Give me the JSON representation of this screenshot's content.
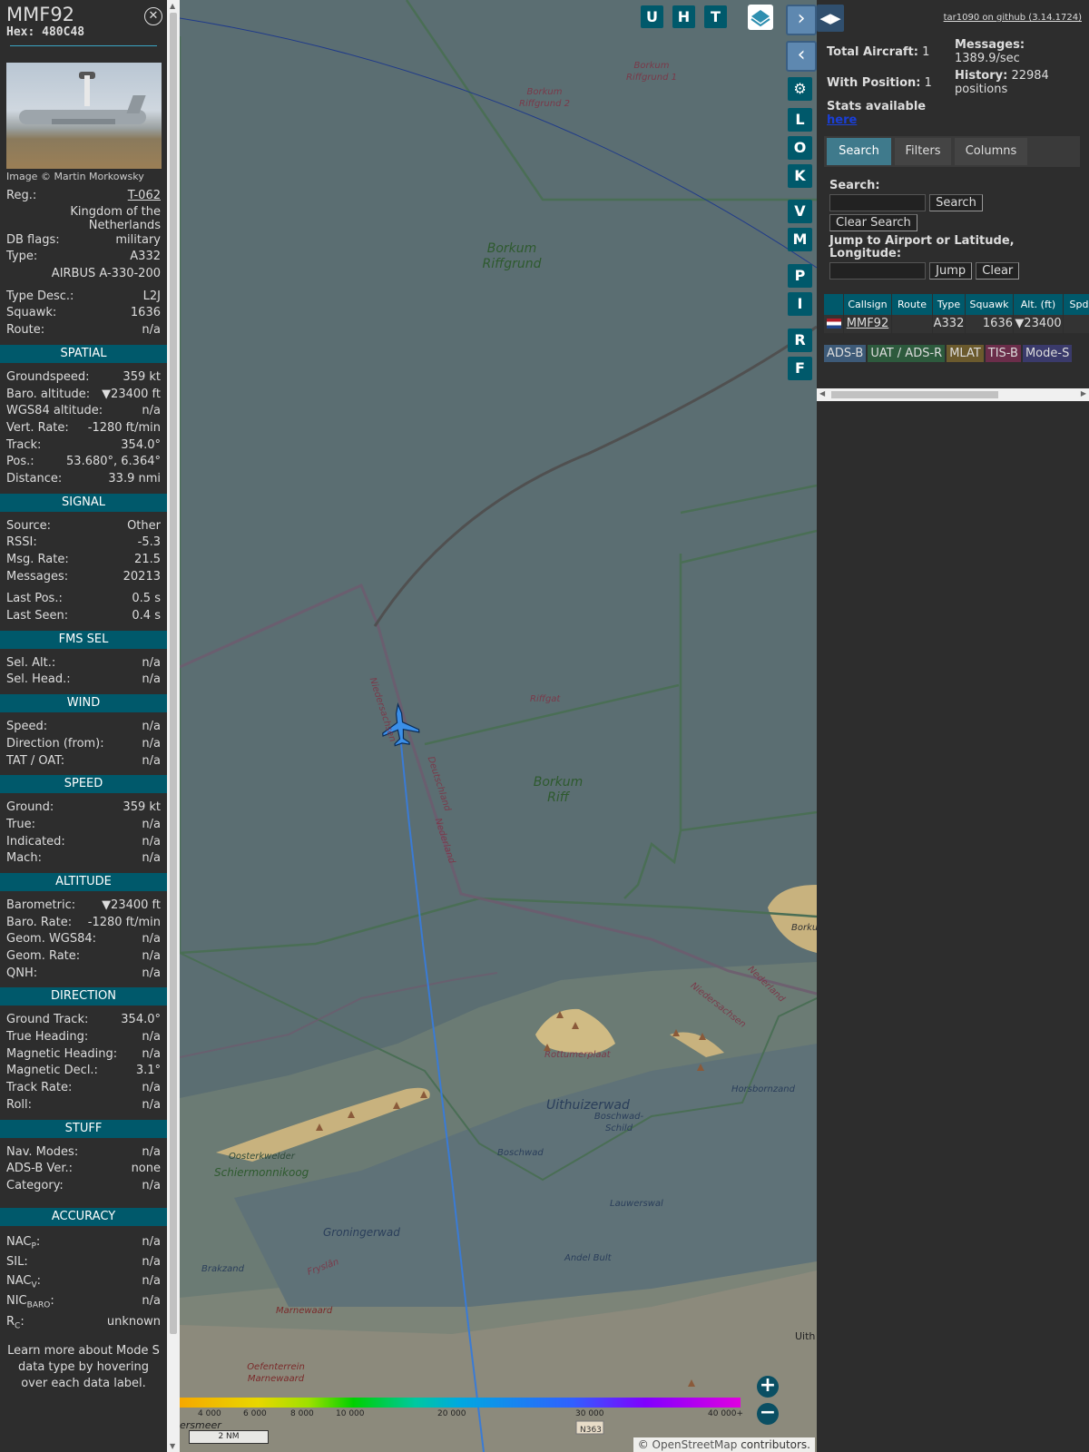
{
  "info": {
    "callsign": "MMF92",
    "hex_label": "Hex:",
    "hex": "480C48",
    "photo_credit": "Image © Martin Morkowsky",
    "header_rows": [
      {
        "k": "Reg.:",
        "v": "T-062"
      }
    ],
    "country": "Kingdom of the Netherlands",
    "rows_a": [
      {
        "k": "DB flags:",
        "v": "military"
      },
      {
        "k": "Type:",
        "v": "A332"
      }
    ],
    "type_full": "AIRBUS A-330-200",
    "rows_b": [
      {
        "k": "Type Desc.:",
        "v": "L2J"
      },
      {
        "k": "Squawk:",
        "v": "1636"
      },
      {
        "k": "Route:",
        "v": "n/a"
      }
    ],
    "sections": [
      {
        "title": "SPATIAL",
        "rows": [
          {
            "k": "Groundspeed:",
            "v": "359 kt"
          },
          {
            "k": "Baro. altitude:",
            "v": "▼23400 ft"
          },
          {
            "k": "WGS84 altitude:",
            "v": "n/a"
          },
          {
            "k": "Vert. Rate:",
            "v": "-1280 ft/min"
          },
          {
            "k": "Track:",
            "v": "354.0°"
          },
          {
            "k": "Pos.:",
            "v": "53.680°, 6.364°"
          },
          {
            "k": "Distance:",
            "v": "33.9 nmi"
          }
        ]
      },
      {
        "title": "SIGNAL",
        "rows": [
          {
            "k": "Source:",
            "v": "Other"
          },
          {
            "k": "RSSI:",
            "v": "-5.3"
          },
          {
            "k": "Msg. Rate:",
            "v": "21.5"
          },
          {
            "k": "Messages:",
            "v": "20213"
          },
          {
            "k": "Last Pos.:",
            "v": "0.5 s"
          },
          {
            "k": "Last Seen:",
            "v": "0.4 s"
          }
        ]
      },
      {
        "title": "FMS SEL",
        "rows": [
          {
            "k": "Sel. Alt.:",
            "v": "n/a"
          },
          {
            "k": "Sel. Head.:",
            "v": "n/a"
          }
        ]
      },
      {
        "title": "WIND",
        "rows": [
          {
            "k": "Speed:",
            "v": "n/a"
          },
          {
            "k": "Direction (from):",
            "v": "n/a"
          },
          {
            "k": "TAT / OAT:",
            "v": "n/a"
          }
        ]
      },
      {
        "title": "SPEED",
        "rows": [
          {
            "k": "Ground:",
            "v": "359 kt"
          },
          {
            "k": "True:",
            "v": "n/a"
          },
          {
            "k": "Indicated:",
            "v": "n/a"
          },
          {
            "k": "Mach:",
            "v": "n/a"
          }
        ]
      },
      {
        "title": "ALTITUDE",
        "rows": [
          {
            "k": "Barometric:",
            "v": "▼23400 ft"
          },
          {
            "k": "Baro. Rate:",
            "v": "-1280 ft/min"
          },
          {
            "k": "Geom. WGS84:",
            "v": "n/a"
          },
          {
            "k": "Geom. Rate:",
            "v": "n/a"
          },
          {
            "k": "QNH:",
            "v": "n/a"
          }
        ]
      },
      {
        "title": "DIRECTION",
        "rows": [
          {
            "k": "Ground Track:",
            "v": "354.0°"
          },
          {
            "k": "True Heading:",
            "v": "n/a"
          },
          {
            "k": "Magnetic Heading:",
            "v": "n/a"
          },
          {
            "k": "Magnetic Decl.:",
            "v": "3.1°"
          },
          {
            "k": "Track Rate:",
            "v": "n/a"
          },
          {
            "k": "Roll:",
            "v": "n/a"
          }
        ]
      },
      {
        "title": "STUFF",
        "rows": [
          {
            "k": "Nav. Modes:",
            "v": "n/a"
          },
          {
            "k": "ADS-B Ver.:",
            "v": "none"
          },
          {
            "k": "Category:",
            "v": "n/a"
          }
        ]
      }
    ],
    "accuracy_title": "ACCURACY",
    "accuracy": {
      "nacp_k": "NAC",
      "nacp_sub": "P",
      "nacp_v": "n/a",
      "sil_k": "SIL:",
      "sil_v": "n/a",
      "nacv_k": "NAC",
      "nacv_sub": "V",
      "nacv_v": "n/a",
      "nic_k": "NIC",
      "nic_sub": "BARO",
      "nic_v": "n/a",
      "rc_k": "R",
      "rc_sub": "C",
      "rc_v": "unknown"
    },
    "learn_more": "Learn more about Mode S data type by hovering over each data label."
  },
  "map": {
    "top_buttons": [
      "U",
      "H",
      "T"
    ],
    "side_buttons": [
      "L",
      "O",
      "K",
      "V",
      "M",
      "P",
      "I",
      "R",
      "F"
    ],
    "labels": {
      "borkum_riffgrund": "Borkum Riffgrund",
      "borkum_riffgrund_1": "Borkum Riffgrund 1",
      "borkum_riffgrund_2": "Borkum Riffgrund 2",
      "borkum_riff": "Borkum Riff",
      "riffgat": "Riffgat",
      "niedersachsen": "Niedersachsen",
      "deutschland": "Deutschland",
      "nederland": "Nederland",
      "nederland2": "Nederland",
      "niedersachsen2": "Niedersachsen",
      "borku": "Borku",
      "rottumerplaat": "Rottumerplaat",
      "uithuizerwad": "Uithuizerwad",
      "boschwad_schild": "Boschwad-Schild",
      "horsbornzand": "Horsbornzand",
      "boschwad": "Boschwad",
      "oosterkwelder": "Oosterkwelder",
      "schiermonnikoog": "Schiermonnikoog",
      "lauwerswal": "Lauwerswal",
      "groningerwad": "Groningerwad",
      "fryslan": "Fryslân",
      "brakzand": "Brakzand",
      "andel_bult": "Andel Bult",
      "marnewaard": "Marnewaard",
      "oefenterrein": "Oefenterrein Marnewaard",
      "uith": "Uith",
      "ersmeer": "ersmeer",
      "n363": "N363"
    },
    "colorbar_ticks": [
      "4 000",
      "6 000",
      "8 000",
      "10 000",
      "20 000",
      "30 000",
      "40 000+"
    ],
    "scale": "2 NM",
    "attribution_prefix": "© ",
    "attribution_link": "OpenStreetMap",
    "attribution_suffix": " contributors.",
    "zoom_in": "+",
    "zoom_out": "−"
  },
  "sidebar": {
    "github": "tar1090 on github (3.14.1724)",
    "total_aircraft_label": "Total Aircraft:",
    "total_aircraft": "1",
    "with_position_label": "With Position:",
    "with_position": "1",
    "messages_label": "Messages:",
    "messages_value": "1389.9/sec",
    "history_label": "History:",
    "history_value": "22984",
    "history_unit": "positions",
    "stats_label": "Stats available",
    "stats_link": "here",
    "tabs": [
      "Search",
      "Filters",
      "Columns"
    ],
    "search_label": "Search:",
    "search_button": "Search",
    "clear_search_button": "Clear Search",
    "jump_label": "Jump to Airport or Latitude, Longitude:",
    "jump_button": "Jump",
    "clear_button": "Clear",
    "table": {
      "headers": [
        "Callsign",
        "Route",
        "Type",
        "Squawk",
        "Alt. (ft)",
        "Spd"
      ],
      "rows": [
        {
          "callsign": "MMF92",
          "route": "",
          "type": "A332",
          "squawk": "1636",
          "alt": "▼23400",
          "spd": ""
        }
      ]
    },
    "legend": [
      {
        "label": "ADS-B",
        "color": "#3d5a78"
      },
      {
        "label": "UAT / ADS-R",
        "color": "#2d5a3d"
      },
      {
        "label": "MLAT",
        "color": "#6b5a2d"
      },
      {
        "label": "TIS-B",
        "color": "#6b2d4a"
      },
      {
        "label": "Mode-S",
        "color": "#3a3a6b"
      }
    ]
  }
}
